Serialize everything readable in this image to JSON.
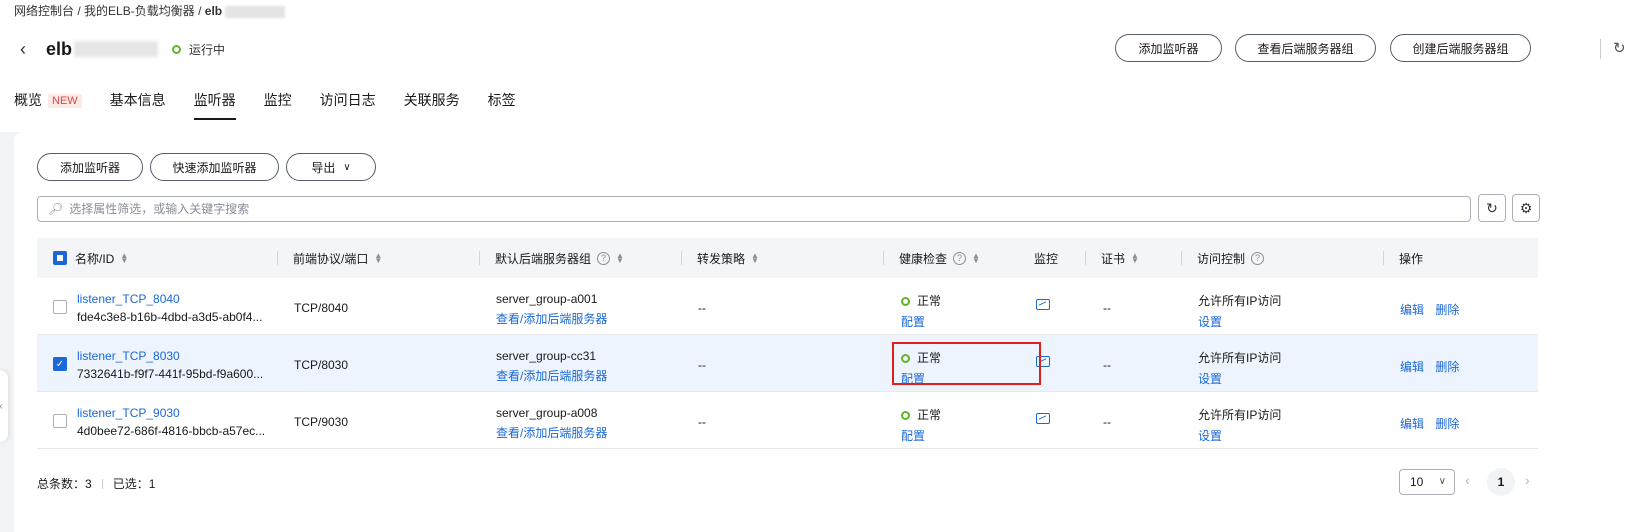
{
  "breadcrumb": {
    "console": "网络控制台",
    "sep": "/",
    "elb_list": "我的ELB-负载均衡器",
    "current": "elb"
  },
  "header": {
    "title": "elb",
    "status": "运行中",
    "buttons": [
      "添加监听器",
      "查看后端服务器组",
      "创建后端服务器组"
    ]
  },
  "tabs": [
    {
      "label": "概览",
      "badge": "NEW"
    },
    {
      "label": "基本信息"
    },
    {
      "label": "监听器",
      "active": true
    },
    {
      "label": "监控"
    },
    {
      "label": "访问日志"
    },
    {
      "label": "关联服务"
    },
    {
      "label": "标签"
    }
  ],
  "toolbar": {
    "add_listener": "添加监听器",
    "quick_add": "快速添加监听器",
    "export": "导出"
  },
  "search": {
    "placeholder": "选择属性筛选，或输入关键字搜索"
  },
  "table": {
    "columns": [
      "名称/ID",
      "前端协议/端口",
      "默认后端服务器组",
      "转发策略",
      "健康检查",
      "监控",
      "证书",
      "访问控制",
      "操作"
    ],
    "rows": [
      {
        "name": "listener_TCP_8040",
        "id": "fde4c3e8-b16b-4dbd-a3d5-ab0f4...",
        "protocol_port": "TCP/8040",
        "server_group": "server_group-a001",
        "server_group_link": "查看/添加后端服务器",
        "forward_policy": "--",
        "health_status": "正常",
        "health_config": "配置",
        "certificate": "--",
        "access_control": "允许所有IP访问",
        "access_setting": "设置",
        "edit": "编辑",
        "delete": "删除",
        "selected": false
      },
      {
        "name": "listener_TCP_8030",
        "id": "7332641b-f9f7-441f-95bd-f9a600...",
        "protocol_port": "TCP/8030",
        "server_group": "server_group-cc31",
        "server_group_link": "查看/添加后端服务器",
        "forward_policy": "--",
        "health_status": "正常",
        "health_config": "配置",
        "certificate": "--",
        "access_control": "允许所有IP访问",
        "access_setting": "设置",
        "edit": "编辑",
        "delete": "删除",
        "selected": true
      },
      {
        "name": "listener_TCP_9030",
        "id": "4d0bee72-686f-4816-bbcb-a57ec...",
        "protocol_port": "TCP/9030",
        "server_group": "server_group-a008",
        "server_group_link": "查看/添加后端服务器",
        "forward_policy": "--",
        "health_status": "正常",
        "health_config": "配置",
        "certificate": "--",
        "access_control": "允许所有IP访问",
        "access_setting": "设置",
        "edit": "编辑",
        "delete": "删除",
        "selected": false
      }
    ]
  },
  "footer": {
    "total_label": "总条数：3",
    "selected_label": "已选：1"
  },
  "pagination": {
    "page_size": "10",
    "current_page": "1"
  },
  "colors": {
    "accent": "#1a68d6",
    "status_ok": "#5fb527",
    "highlight": "#e0201a"
  }
}
